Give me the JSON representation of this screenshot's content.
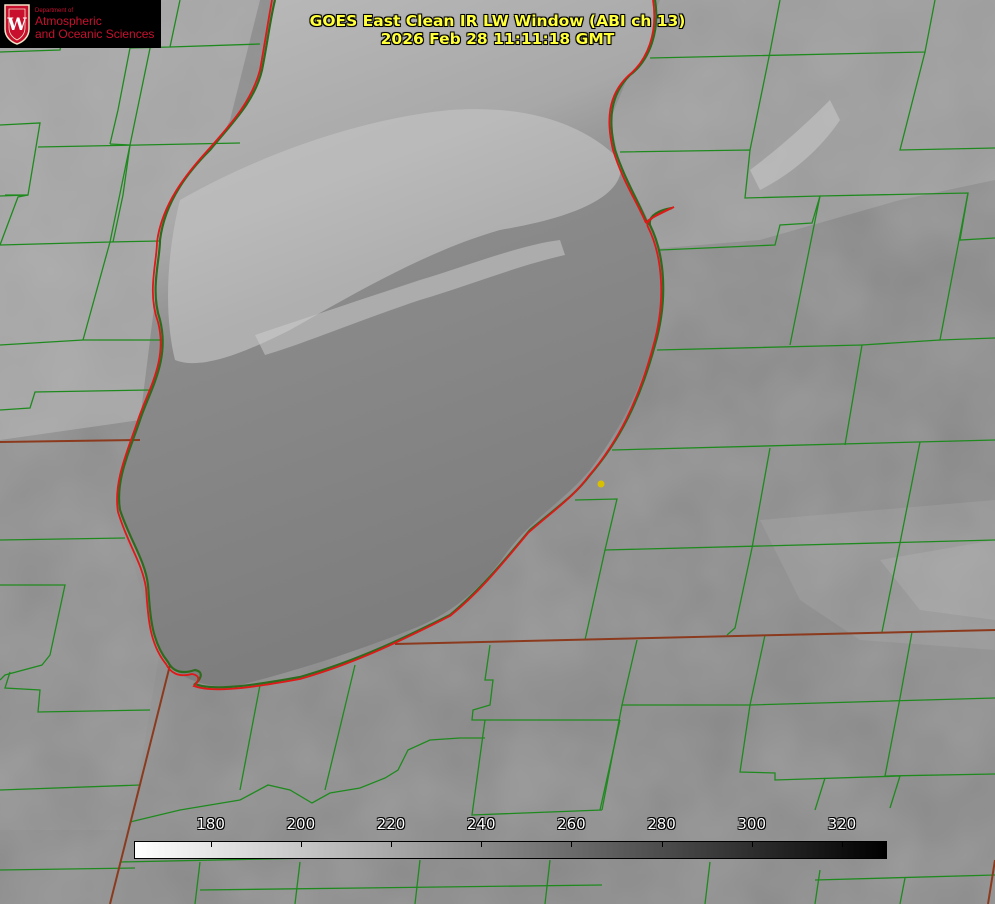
{
  "header": {
    "title_line1": "GOES East Clean IR LW Window (ABI ch 13)",
    "title_line2": "2026 Feb 28 11:11:18 GMT"
  },
  "logo": {
    "department": "Department of",
    "line1": "Atmospheric",
    "line2": "and Oceanic Sciences",
    "crest_letter": "W"
  },
  "colorbar": {
    "ticks": [
      "180",
      "200",
      "220",
      "240",
      "260",
      "280",
      "300",
      "320"
    ],
    "tick_values": [
      180,
      200,
      220,
      240,
      260,
      280,
      300,
      320
    ],
    "range": [
      163,
      330
    ],
    "gradient_colors": [
      "#ffffff",
      "#000000"
    ]
  },
  "map": {
    "overlay_colors": {
      "county_lines": "#1e8a1e",
      "state_lines": "#8b3a1e",
      "lake_shore_highlight": "#e01818",
      "point_marker": "#d8c000"
    }
  }
}
